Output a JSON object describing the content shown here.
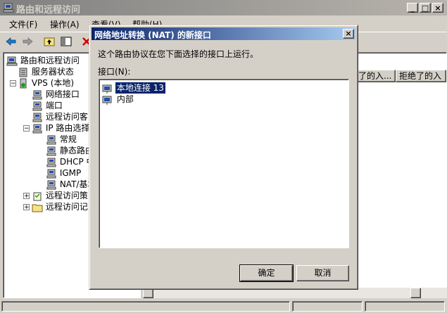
{
  "main_window": {
    "title": "路由和远程访问",
    "caption_buttons": {
      "minimize": "_",
      "maximize": "□",
      "close": "×"
    }
  },
  "menu": [
    {
      "label": "文件(F)"
    },
    {
      "label": "操作(A)"
    },
    {
      "label": "查看(V)"
    },
    {
      "label": "帮助(H)"
    }
  ],
  "toolbar": {
    "icons": [
      "back-arrow-icon",
      "forward-arrow-icon",
      "up-folder-icon",
      "show-hide-tree-icon",
      "delete-icon"
    ]
  },
  "tree": {
    "items": [
      {
        "label": "路由和远程访问",
        "icon": "computer-icon"
      },
      {
        "label": "服务器状态",
        "icon": "server-list-icon"
      },
      {
        "label": "VPS (本地)",
        "icon": "server-icon"
      },
      {
        "label": "网络接口",
        "icon": "network-icon"
      },
      {
        "label": "端口",
        "icon": "network-icon"
      },
      {
        "label": "远程访问客",
        "icon": "network-icon"
      },
      {
        "label": "IP 路由选择",
        "icon": "network-icon"
      },
      {
        "label": "常规",
        "icon": "network-icon"
      },
      {
        "label": "静态路由",
        "icon": "network-icon"
      },
      {
        "label": "DHCP 中",
        "icon": "network-icon"
      },
      {
        "label": "IGMP",
        "icon": "network-icon"
      },
      {
        "label": "NAT/基本",
        "icon": "network-icon"
      },
      {
        "label": "远程访问策",
        "icon": "policy-icon"
      },
      {
        "label": "远程访问记",
        "icon": "folder-icon"
      }
    ]
  },
  "list": {
    "columns": [
      "了的入...",
      "拒绝了的入"
    ]
  },
  "dialog": {
    "title": "网络地址转换 (NAT) 的新接口",
    "close_label": "×",
    "description": "这个路由协议在您下面选择的接口上运行。",
    "interfaces_label": "接口(N):",
    "interfaces": [
      {
        "label": "本地连接 13",
        "selected": true
      },
      {
        "label": "内部",
        "selected": false
      }
    ],
    "ok_label": "确定",
    "cancel_label": "取消"
  }
}
